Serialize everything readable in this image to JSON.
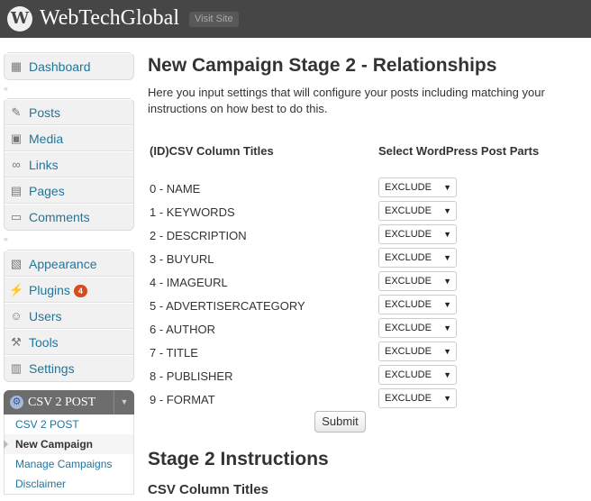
{
  "header": {
    "site_title": "WebTechGlobal",
    "visit_site": "Visit Site",
    "logo_glyph": "W"
  },
  "sidebar": {
    "group1": [
      {
        "label": "Dashboard",
        "icon": "dashboard-icon"
      }
    ],
    "group2": [
      {
        "label": "Posts",
        "icon": "pin-icon"
      },
      {
        "label": "Media",
        "icon": "media-icon"
      },
      {
        "label": "Links",
        "icon": "link-icon"
      },
      {
        "label": "Pages",
        "icon": "page-icon"
      },
      {
        "label": "Comments",
        "icon": "comment-icon"
      }
    ],
    "group3": [
      {
        "label": "Appearance",
        "icon": "appearance-icon"
      },
      {
        "label": "Plugins",
        "icon": "plugin-icon",
        "badge": "4"
      },
      {
        "label": "Users",
        "icon": "users-icon"
      },
      {
        "label": "Tools",
        "icon": "tools-icon"
      },
      {
        "label": "Settings",
        "icon": "settings-icon"
      }
    ],
    "plugin_menu": {
      "title": "CSV 2 POST",
      "items": [
        "CSV 2 POST",
        "New Campaign",
        "Manage Campaigns",
        "Disclaimer"
      ],
      "current": "New Campaign"
    }
  },
  "main": {
    "title": "New Campaign Stage 2 - Relationships",
    "intro_line1": "Here you input settings that will configure your posts including matching your",
    "intro_line2": "instructions on how best to do this.",
    "col_left": "(ID)CSV Column Titles",
    "col_right": "Select WordPress Post Parts",
    "rows": [
      {
        "csv": "0 - NAME",
        "value": "EXCLUDE"
      },
      {
        "csv": "1 - KEYWORDS",
        "value": "EXCLUDE"
      },
      {
        "csv": "2 - DESCRIPTION",
        "value": "EXCLUDE"
      },
      {
        "csv": "3 - BUYURL",
        "value": "EXCLUDE"
      },
      {
        "csv": "4 - IMAGEURL",
        "value": "EXCLUDE"
      },
      {
        "csv": "5 - ADVERTISERCATEGORY",
        "value": "EXCLUDE"
      },
      {
        "csv": "6 - AUTHOR",
        "value": "EXCLUDE"
      },
      {
        "csv": "7 - TITLE",
        "value": "EXCLUDE"
      },
      {
        "csv": "8 - PUBLISHER",
        "value": "EXCLUDE"
      },
      {
        "csv": "9 - FORMAT",
        "value": "EXCLUDE"
      }
    ],
    "submit": "Submit",
    "stage2_title": "Stage 2 Instructions",
    "csv_subheading": "CSV Column Titles"
  }
}
